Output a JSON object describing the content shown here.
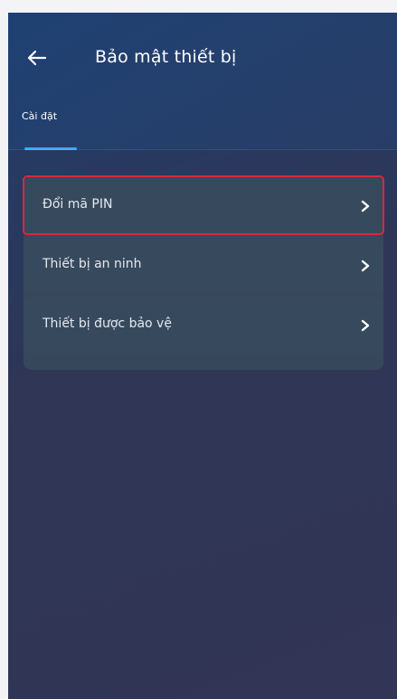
{
  "header": {
    "back_icon": "arrow-left-icon",
    "title": "Bảo mật thiết bị"
  },
  "tabs": [
    {
      "label": "Cài đặt",
      "active": true
    }
  ],
  "menu": {
    "items": [
      {
        "label": "Đổi mã PIN",
        "icon": "chevron-right-icon",
        "highlighted": true
      },
      {
        "label": "Thiết bị an ninh",
        "icon": "chevron-right-icon"
      },
      {
        "label": "Thiết bị được bảo vệ",
        "icon": "chevron-right-icon"
      }
    ]
  },
  "colors": {
    "accent": "#3fa9f5",
    "highlight_border": "#d8283a",
    "card": "#374a5d"
  }
}
